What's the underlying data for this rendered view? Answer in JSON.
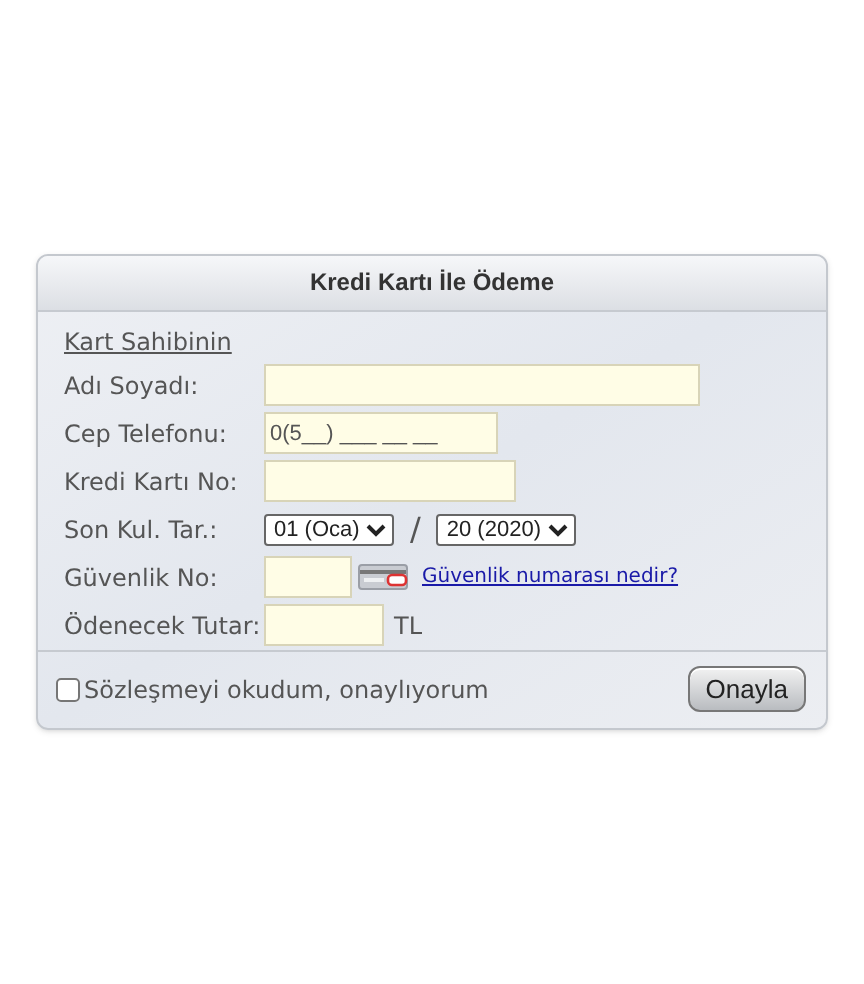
{
  "title": "Kredi Kartı İle Ödeme",
  "section_label": "Kart Sahibinin",
  "fields": [
    {
      "kind": "text",
      "label": "Adı Soyadı:"
    },
    {
      "kind": "text",
      "label": "Cep Telefonu:",
      "value": "0(5__) ___ __ __"
    },
    {
      "kind": "text",
      "label": "Kredi Kartı No:"
    },
    {
      "kind": "date",
      "label": "Son Kul. Tar.:",
      "month": "01 (Oca)",
      "separator": "/",
      "year": "20 (2020)"
    },
    {
      "kind": "cvv",
      "label": "Güvenlik No:",
      "link": "Güvenlik numarası nedir?"
    },
    {
      "kind": "amount",
      "label": "Ödenecek Tutar:",
      "unit": "TL"
    }
  ],
  "agreement": {
    "label": "Sözleşmeyi okudum, onaylıyorum",
    "checked": false
  },
  "button": "Onayla"
}
